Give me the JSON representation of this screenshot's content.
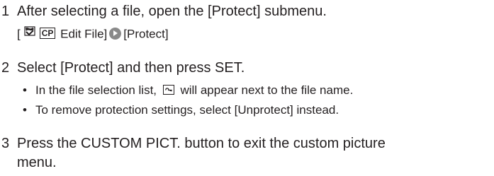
{
  "steps": [
    {
      "number": "1",
      "text": "After selecting a file, open the [Protect] submenu.",
      "path": {
        "open_bracket": "[",
        "cp_label": "CP",
        "edit_file": "Edit File]",
        "target": "[Protect]"
      }
    },
    {
      "number": "2",
      "text": "Select [Protect] and then press SET.",
      "bullets": [
        {
          "before": "In the file selection list,",
          "after": "will appear next to the file name."
        },
        {
          "text": "To remove protection settings, select [Unprotect] instead."
        }
      ]
    },
    {
      "number": "3",
      "text": "Press the CUSTOM PICT. button to exit the custom picture",
      "continuation": "menu."
    }
  ],
  "icons": {
    "custom_picture": "custom-picture-icon",
    "arrow": "right-arrow-circle-icon",
    "protect": "protect-icon"
  }
}
